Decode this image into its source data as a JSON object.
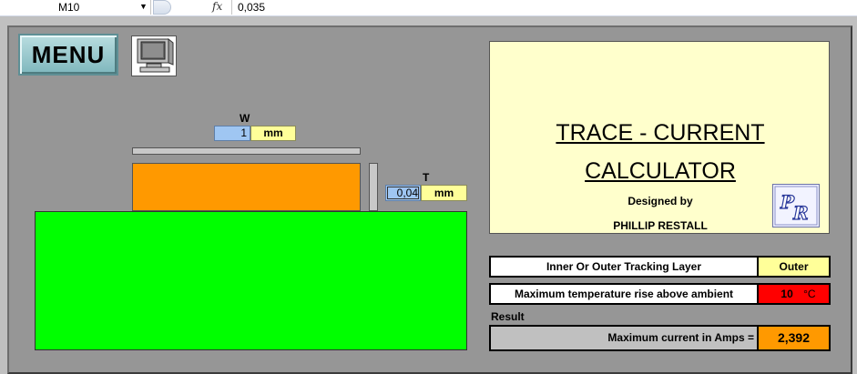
{
  "formula_bar": {
    "cell_reference": "M10",
    "fx_label": "fx",
    "formula_value": "0,035"
  },
  "menu": {
    "label": "MENU"
  },
  "diagram": {
    "width_label": "W",
    "width_value": "1",
    "width_unit": "mm",
    "thickness_label": "T",
    "thickness_value": "0,04",
    "thickness_unit": "mm"
  },
  "title_box": {
    "title_line1": "TRACE - CURRENT",
    "title_line2": "CALCULATOR",
    "designed_by": "Designed by",
    "author": "PHILLIP RESTALL",
    "logo_text": "PR"
  },
  "parameters": {
    "layer_label": "Inner Or Outer Tracking Layer",
    "layer_value": "Outer",
    "temp_label": "Maximum temperature rise above ambient",
    "temp_value": "10",
    "temp_unit": "°C"
  },
  "result": {
    "section_label": "Result",
    "label": "Maximum current in Amps =",
    "value": "2,392"
  },
  "colors": {
    "panel_bg": "#969696",
    "board": "#00ff00",
    "copper": "#ff9900",
    "input_blue": "#9fc6f2",
    "unit_yellow": "#ffff99",
    "title_bg": "#ffffcc",
    "temp_red": "#ff0000"
  }
}
